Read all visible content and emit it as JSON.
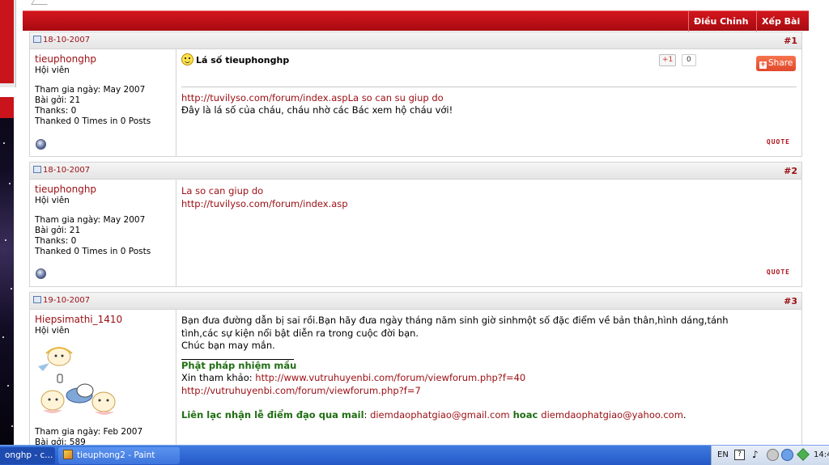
{
  "toolbar": {
    "edit_label": "Điều Chỉnh",
    "sort_label": "Xếp Bài"
  },
  "posts": [
    {
      "date": "18-10-2007",
      "number": "#1",
      "username": "tieuphonghp",
      "user_title": "Hội viên",
      "joined": "Tham gia ngày: May 2007",
      "posts_count": "Bài gởi: 21",
      "thanks": "Thanks: 0",
      "thanked": "Thanked 0 Times in 0 Posts",
      "title": "Lá số tieuphonghp",
      "gplus_label": "+1",
      "gplus_count": "0",
      "share_label": "Share",
      "link": "http://tuvilyso.com/forum/index.aspLa so can su giup do",
      "message": "Đây là lá số của cháu, cháu nhờ các Bác xem hộ cháu với!",
      "quote_label": "QUOTE"
    },
    {
      "date": "18-10-2007",
      "number": "#2",
      "username": "tieuphonghp",
      "user_title": "Hội viên",
      "joined": "Tham gia ngày: May 2007",
      "posts_count": "Bài gởi: 21",
      "thanks": "Thanks: 0",
      "thanked": "Thanked 0 Times in 0 Posts",
      "line1": "La so can giup do",
      "line2": "http://tuvilyso.com/forum/index.asp",
      "quote_label": "QUOTE"
    },
    {
      "date": "19-10-2007",
      "number": "#3",
      "username": "Hiepsimathi_1410",
      "user_title": "Hội viên",
      "joined": "Tham gia ngày: Feb 2007",
      "posts_count": "Bài gởi: 589",
      "line1": "Bạn đưa đường dẫn bị sai rồi.Bạn hãy đưa ngày tháng năm sinh giờ sinhmột số đặc điểm về bản thân,hình dáng,tánh",
      "line2": "tình,các sự kiện nổi bật diễn ra trong cuộc đời bạn.",
      "line3": "Chúc bạn may mắn.",
      "sig_title": "Phật pháp nhiệm mầu",
      "sig_ref_label": "Xin tham khảo: ",
      "sig_link1": "http://www.vutruhuyenbi.com/forum/viewforum.php?f=40",
      "sig_link2": "http://vutruhuyenbi.com/forum/viewforum.php?f=7",
      "contact_label": "Liên lạc nhận lễ điểm đạo qua mail",
      "contact_colon": ": ",
      "email1": "diemdaophatgiao@gmail.com",
      "or_label": " hoac ",
      "email2": "diemdaophatgiao@yahoo.com",
      "email_end": "."
    }
  ],
  "taskbar": {
    "task1": "onghp - c...",
    "task2": "tieuphong2 - Paint",
    "lang": "EN",
    "clock": "14:4"
  },
  "colors": {
    "forum_red": "#c9141b",
    "link_red": "#9b0d12",
    "sig_green": "#1f6e12",
    "taskbar_blue": "#2458c7"
  }
}
